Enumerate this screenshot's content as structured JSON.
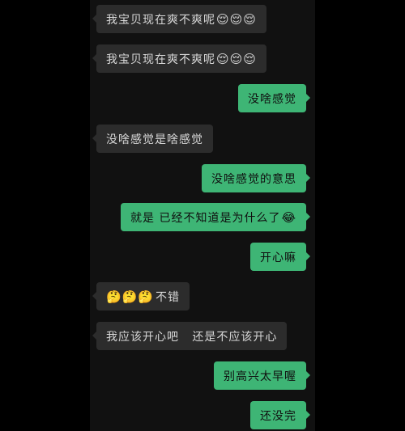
{
  "messages": [
    {
      "side": "left",
      "text": "我宝贝现在爽不爽呢",
      "emoji": "😌😌😌"
    },
    {
      "side": "left",
      "text": "我宝贝现在爽不爽呢",
      "emoji": "😌😌😌"
    },
    {
      "side": "right",
      "text": "没啥感觉",
      "emoji": ""
    },
    {
      "side": "left",
      "text": "没啥感觉是啥感觉",
      "emoji": ""
    },
    {
      "side": "right",
      "text": "没啥感觉的意思",
      "emoji": ""
    },
    {
      "side": "right",
      "text": "就是 已经不知道是为什么了",
      "emoji": "😂"
    },
    {
      "side": "right",
      "text": "开心嘛",
      "emoji": ""
    },
    {
      "side": "left",
      "text": "不错",
      "emoji": "🤔🤔🤔",
      "emoji_first": true
    },
    {
      "side": "left",
      "text": "我应该开心吧   还是不应该开心",
      "emoji": ""
    },
    {
      "side": "right",
      "text": "别高兴太早喔",
      "emoji": ""
    },
    {
      "side": "right",
      "text": "还没完",
      "emoji": ""
    }
  ]
}
